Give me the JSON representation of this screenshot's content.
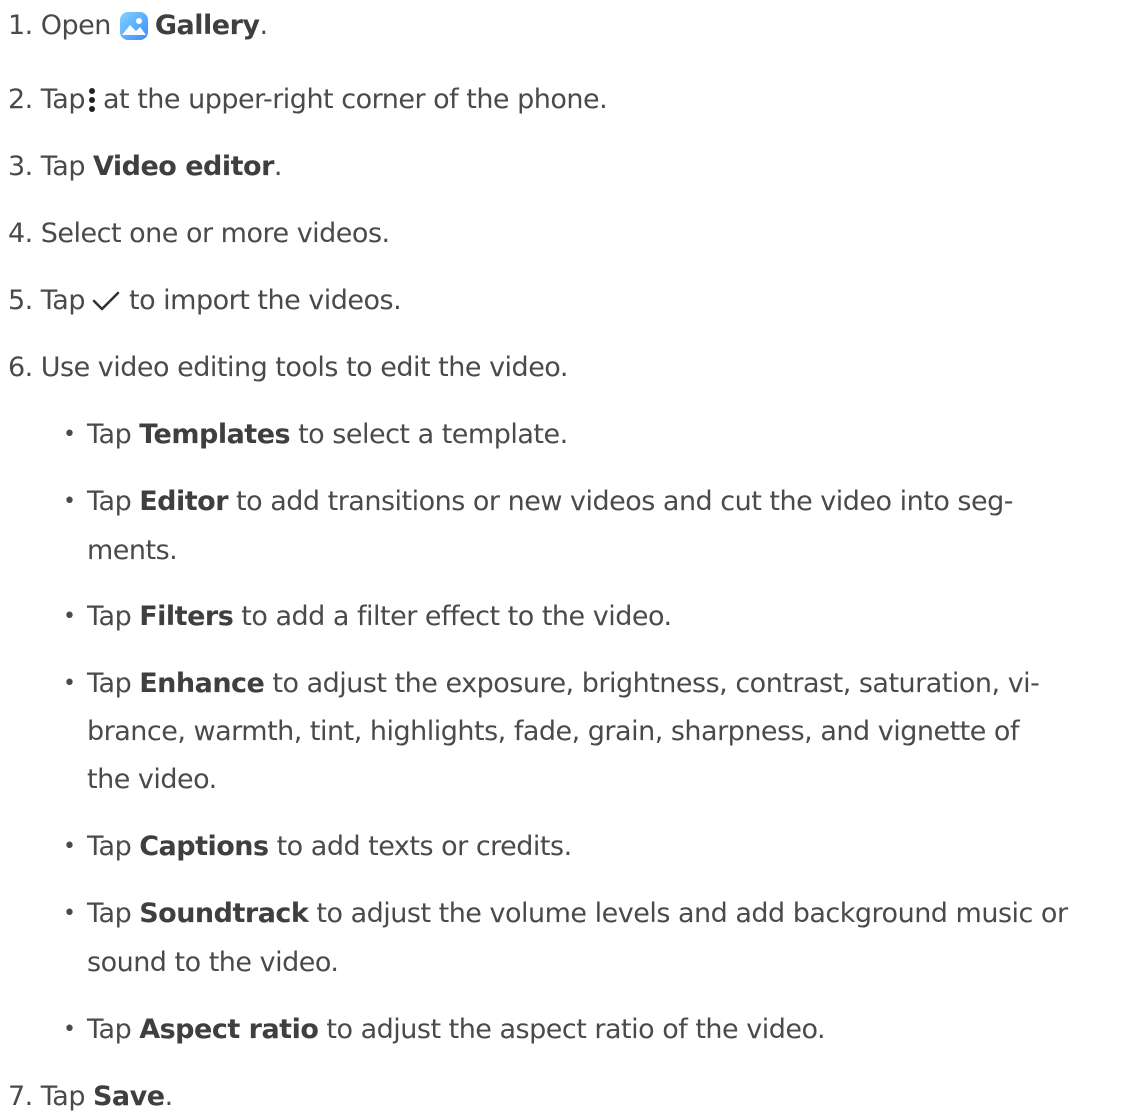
{
  "steps": [
    {
      "num": "1.",
      "pre": "Open",
      "bold": "Gallery",
      "post": "."
    },
    {
      "num": "2.",
      "pre": "Tap",
      "post": "at the upper-right corner of the phone."
    },
    {
      "num": "3.",
      "pre": "Tap",
      "bold": "Video editor",
      "post": "."
    },
    {
      "num": "4.",
      "text": "Select one or more videos."
    },
    {
      "num": "5.",
      "pre": "Tap",
      "post": "to import the videos."
    },
    {
      "num": "6.",
      "text": "Use video editing tools to edit the video."
    },
    {
      "num": "7.",
      "pre": "Tap",
      "bold": "Save",
      "post": "."
    }
  ],
  "bullets": [
    {
      "pre": "Tap",
      "bold": "Templates",
      "lines": [
        "to select a template."
      ]
    },
    {
      "pre": "Tap",
      "bold": "Editor",
      "lines": [
        "to add transitions or new videos and cut the video into seg-",
        "ments."
      ]
    },
    {
      "pre": "Tap",
      "bold": "Filters",
      "lines": [
        "to add a filter effect to the video."
      ]
    },
    {
      "pre": "Tap",
      "bold": "Enhance",
      "lines": [
        "to adjust the exposure, brightness, contrast, saturation, vi-",
        "brance, warmth, tint, highlights, fade, grain, sharpness, and vignette of",
        "the video."
      ]
    },
    {
      "pre": "Tap",
      "bold": "Captions",
      "lines": [
        "to add texts or credits."
      ]
    },
    {
      "pre": "Tap",
      "bold": "Soundtrack",
      "lines": [
        "to adjust the volume levels and add background music or",
        "sound to the video."
      ]
    },
    {
      "pre": "Tap",
      "bold": "Aspect ratio",
      "lines": [
        "to adjust the aspect ratio of the video."
      ]
    }
  ],
  "bullet_char": "•",
  "icons": {
    "gallery": "gallery-app-icon",
    "more": "more-vertical-icon",
    "check": "checkmark-icon"
  }
}
